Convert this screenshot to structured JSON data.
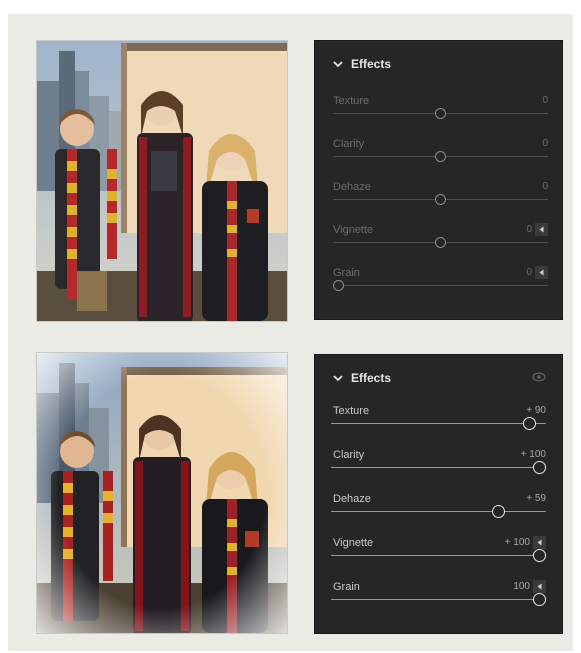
{
  "before": {
    "panel": {
      "title": "Effects",
      "icons": {
        "collapse": "chevron-down-icon"
      },
      "sliders": [
        {
          "label": "Texture",
          "value": "0",
          "position": 0.5,
          "has_arrow": false
        },
        {
          "label": "Clarity",
          "value": "0",
          "position": 0.5,
          "has_arrow": false
        },
        {
          "label": "Dehaze",
          "value": "0",
          "position": 0.5,
          "has_arrow": false
        },
        {
          "label": "Vignette",
          "value": "0",
          "position": 0.5,
          "has_arrow": true
        },
        {
          "label": "Grain",
          "value": "0",
          "position": 0.0,
          "has_arrow": true
        }
      ]
    }
  },
  "after": {
    "panel": {
      "title": "Effects",
      "icons": {
        "collapse": "chevron-down-icon",
        "visibility": "eye-icon"
      },
      "sliders": [
        {
          "label": "Texture",
          "value": "+ 90",
          "position": 0.95,
          "has_arrow": false
        },
        {
          "label": "Clarity",
          "value": "+ 100",
          "position": 1.0,
          "has_arrow": false
        },
        {
          "label": "Dehaze",
          "value": "+ 59",
          "position": 0.795,
          "has_arrow": false
        },
        {
          "label": "Vignette",
          "value": "+ 100",
          "position": 1.0,
          "has_arrow": true
        },
        {
          "label": "Grain",
          "value": "100",
          "position": 1.0,
          "has_arrow": true
        }
      ]
    }
  },
  "colors": {
    "frame_bg": "#ebebe6",
    "panel_bg": "#262626",
    "scarf_red": "#8e1c22",
    "scarf_gold": "#e0b12d"
  }
}
